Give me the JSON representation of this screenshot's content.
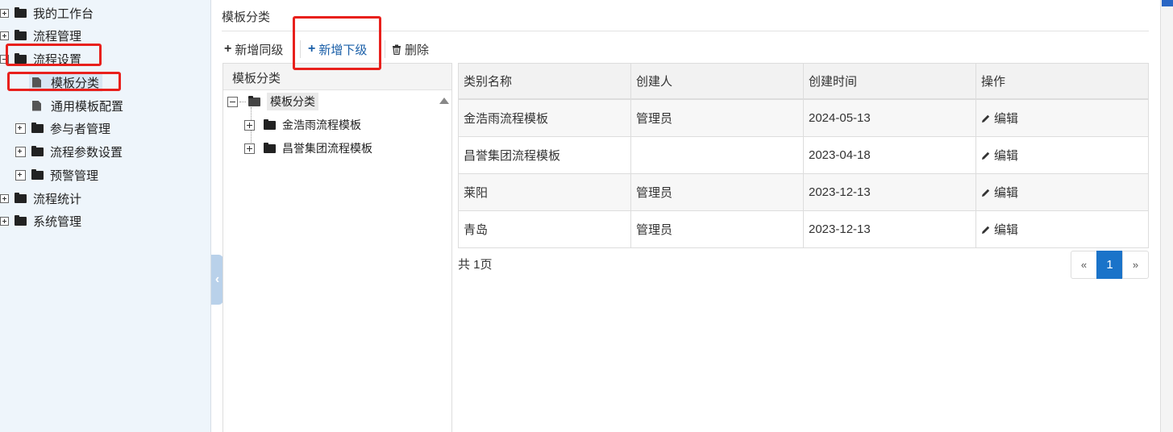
{
  "sidebar": {
    "items": [
      {
        "label": "我的工作台"
      },
      {
        "label": "流程管理"
      },
      {
        "label": "流程设置"
      },
      {
        "label": "模板分类"
      },
      {
        "label": "通用模板配置"
      },
      {
        "label": "参与者管理"
      },
      {
        "label": "流程参数设置"
      },
      {
        "label": "预警管理"
      },
      {
        "label": "流程统计"
      },
      {
        "label": "系统管理"
      }
    ]
  },
  "main": {
    "title": "模板分类",
    "toolbar": {
      "add_sibling": "新增同级",
      "add_child": "新增下级",
      "delete": "删除"
    },
    "tree": {
      "header": "模板分类",
      "root": "模板分类",
      "children": [
        "金浩雨流程模板",
        "昌誉集团流程模板"
      ]
    },
    "table": {
      "columns": [
        "类别名称",
        "创建人",
        "创建时间",
        "操作"
      ],
      "rows": [
        {
          "name": "金浩雨流程模板",
          "creator": "管理员",
          "date": "2024-05-13",
          "action": "编辑"
        },
        {
          "name": "昌誉集团流程模板",
          "creator": "",
          "date": "2023-04-18",
          "action": "编辑"
        },
        {
          "name": "莱阳",
          "creator": "管理员",
          "date": "2023-12-13",
          "action": "编辑"
        },
        {
          "name": "青岛",
          "creator": "管理员",
          "date": "2023-12-13",
          "action": "编辑"
        }
      ]
    },
    "pagination": {
      "summary": "共 1页",
      "prev": "«",
      "current": "1",
      "next": "»"
    }
  },
  "colors": {
    "accent": "#1a73c9",
    "annotation": "#e8201c",
    "sidebar_bg": "#eef5fb"
  }
}
